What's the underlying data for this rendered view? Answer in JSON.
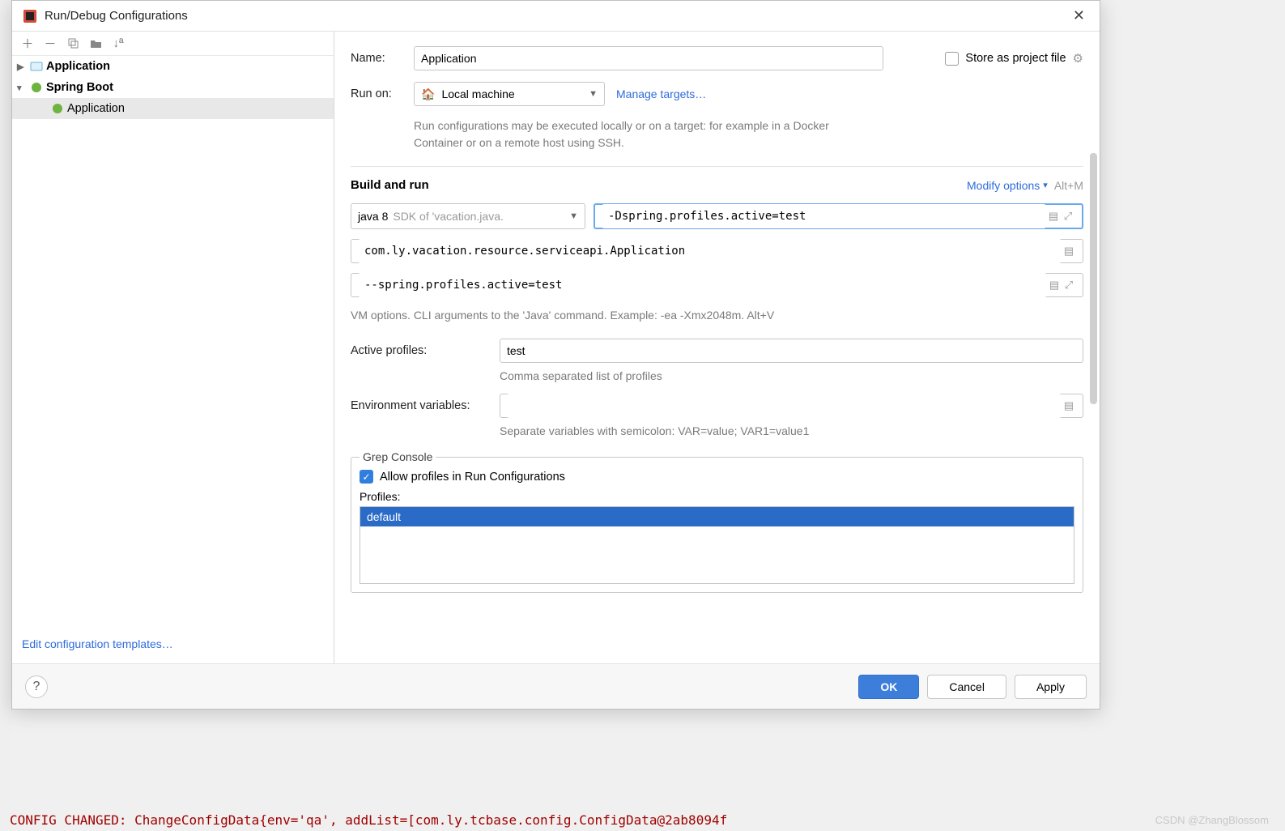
{
  "dialog": {
    "title": "Run/Debug Configurations"
  },
  "tree": {
    "nodes": [
      {
        "label": "Application",
        "bold": true,
        "expanded": false,
        "icon": "app"
      },
      {
        "label": "Spring Boot",
        "bold": true,
        "expanded": true,
        "icon": "spring"
      },
      {
        "label": "Application",
        "bold": false,
        "child": true,
        "selected": true,
        "icon": "spring"
      }
    ],
    "edit_templates": "Edit configuration templates…"
  },
  "form": {
    "name_label": "Name:",
    "name_value": "Application",
    "store_label": "Store as project file",
    "runon_label": "Run on:",
    "runon_value": "Local machine",
    "manage_targets": "Manage targets…",
    "runon_hint": "Run configurations may be executed locally or on a target: for example in a Docker Container or on a remote host using SSH.",
    "build_title": "Build and run",
    "modify_options": "Modify options",
    "modify_shortcut": "Alt+M",
    "jdk_main": "java 8",
    "jdk_grey": "SDK of 'vacation.java.",
    "vm_options": "-Dspring.profiles.active=test",
    "main_class": "com.ly.vacation.resource.serviceapi.Application",
    "program_args": "--spring.profiles.active=test",
    "vm_hint": "VM options. CLI arguments to the 'Java' command. Example: -ea -Xmx2048m. Alt+V",
    "active_profiles_label": "Active profiles:",
    "active_profiles_value": "test",
    "active_profiles_hint": "Comma separated list of profiles",
    "env_label": "Environment variables:",
    "env_value": "",
    "env_hint": "Separate variables with semicolon: VAR=value; VAR1=value1",
    "grep_legend": "Grep Console",
    "grep_allow": "Allow profiles in Run Configurations",
    "grep_profiles_label": "Profiles:",
    "grep_profiles": [
      "default"
    ]
  },
  "buttons": {
    "ok": "OK",
    "cancel": "Cancel",
    "apply": "Apply"
  },
  "bg": {
    "code": "CONFIG CHANGED: ChangeConfigData{env='qa', addList=[com.ly.tcbase.config.ConfigData@2ab8094f",
    "watermark": "CSDN @ZhangBlossom"
  }
}
